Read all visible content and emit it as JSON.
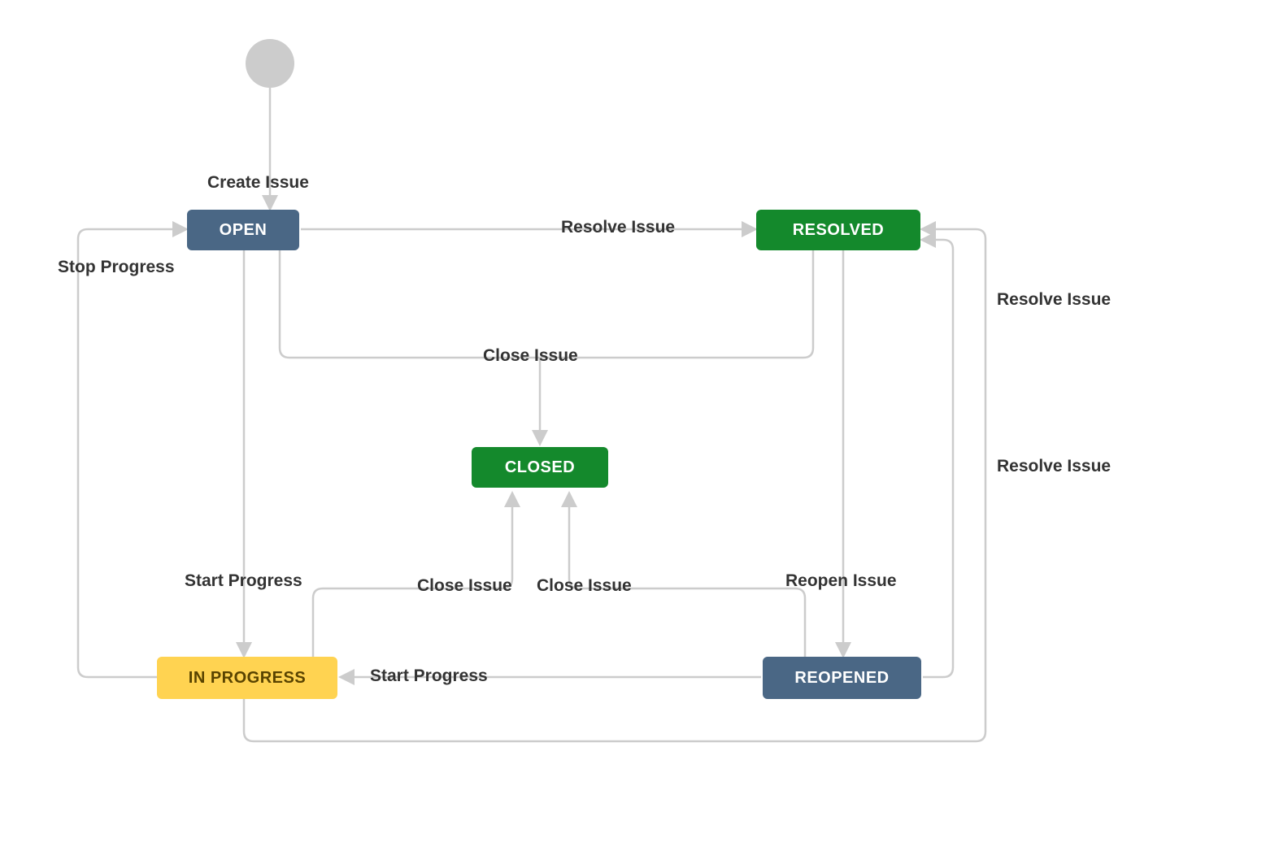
{
  "diagram": {
    "type": "state-machine",
    "start_symbol": "●",
    "nodes": {
      "open": {
        "label": "OPEN",
        "style": "blue"
      },
      "resolved": {
        "label": "RESOLVED",
        "style": "green"
      },
      "closed": {
        "label": "CLOSED",
        "style": "green"
      },
      "in_progress": {
        "label": "IN PROGRESS",
        "style": "yellow"
      },
      "reopened": {
        "label": "REOPENED",
        "style": "blue"
      }
    },
    "transitions": [
      {
        "id": "create_issue",
        "from": "start",
        "to": "open",
        "label": "Create Issue"
      },
      {
        "id": "resolve_open",
        "from": "open",
        "to": "resolved",
        "label": "Resolve Issue"
      },
      {
        "id": "stop_progress",
        "from": "in_progress",
        "to": "open",
        "label": "Stop Progress"
      },
      {
        "id": "close_issue",
        "from": "open",
        "to": "closed",
        "label": "Close Issue"
      },
      {
        "id": "start_open",
        "from": "open",
        "to": "in_progress",
        "label": "Start Progress"
      },
      {
        "id": "close_inprog",
        "from": "in_progress",
        "to": "closed",
        "label": "Close Issue"
      },
      {
        "id": "close_reopened",
        "from": "reopened",
        "to": "closed",
        "label": "Close Issue"
      },
      {
        "id": "reopen_issue",
        "from": "resolved",
        "to": "reopened",
        "label": "Reopen Issue"
      },
      {
        "id": "start_reopened",
        "from": "reopened",
        "to": "in_progress",
        "label": "Start Progress"
      },
      {
        "id": "resolve_inprog",
        "from": "in_progress",
        "to": "resolved",
        "label": "Resolve Issue"
      },
      {
        "id": "resolve_reop",
        "from": "reopened",
        "to": "resolved",
        "label": "Resolve Issue"
      }
    ]
  },
  "colors": {
    "node_blue_bg": "#4a6785",
    "node_green_bg": "#14892c",
    "node_yellow_bg": "#ffd351",
    "node_yellow_fg": "#594300",
    "edge": "#cccccc",
    "label": "#333333"
  }
}
